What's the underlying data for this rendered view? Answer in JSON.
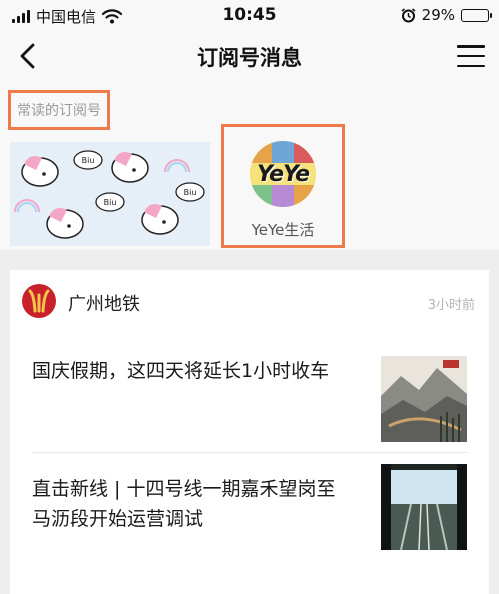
{
  "status_bar": {
    "carrier": "中国电信",
    "time": "10:45",
    "battery_text": "29%",
    "battery_level": 0.29,
    "icons": [
      "signal-icon",
      "wifi-icon",
      "alarm-icon",
      "battery-icon"
    ]
  },
  "nav": {
    "title": "订阅号消息",
    "back_icon": "chevron-left-icon",
    "menu_icon": "hamburger-menu-icon"
  },
  "frequent": {
    "label": "常读的订阅号",
    "items": [
      {
        "name": "YeYe生活",
        "logo_text": "YeYe"
      }
    ]
  },
  "feed": {
    "account_name": "广州地铁",
    "time": "3小时前",
    "articles": [
      {
        "title": "国庆假期，这四天将延长1小时收车"
      },
      {
        "title": "直击新线 | 十四号线一期嘉禾望岗至马沥段开始运营调试"
      }
    ]
  },
  "colors": {
    "highlight_border": "#ee7a4a",
    "metro_red": "#c8212b",
    "metro_gold": "#f3c64a",
    "page_bg": "#eeeeee"
  }
}
